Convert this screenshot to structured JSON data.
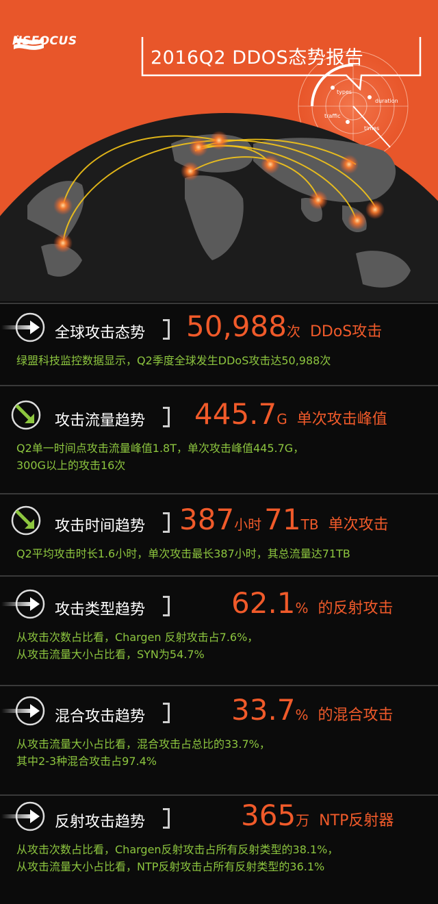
{
  "header": {
    "logo_text": "NSFOCUS",
    "title": "2016Q2 DDOS态势报告",
    "radar_labels": {
      "types": "types",
      "duration": "duration",
      "traffic": "traffic",
      "times": "times"
    }
  },
  "colors": {
    "accent": "#f05a2a",
    "hero_bg": "#e8562a",
    "desc": "#8dc63f"
  },
  "sections": [
    {
      "title": "全球攻击态势",
      "arrow": "right-arrow-icon",
      "num": "50,988",
      "unit": "次",
      "tail": "DDoS攻击",
      "lines": [
        "绿盟科技监控数据显示，Q2季度全球发生DDoS攻击达50,988次"
      ]
    },
    {
      "title": "攻击流量趋势",
      "arrow": "down-right-arrow-icon",
      "num": "445.7",
      "unit": "G",
      "tail": "单次攻击峰值",
      "lines": [
        "Q2单一时间点攻击流量峰值1.8T，单次攻击峰值445.7G，",
        "300G以上的攻击16次"
      ]
    },
    {
      "title": "攻击时间趋势",
      "arrow": "down-right-arrow-icon",
      "num": "387",
      "unit": "小时",
      "num2": "71",
      "unit2": "TB",
      "tail": "单次攻击",
      "lines": [
        "Q2平均攻击时长1.6小时，单次攻击最长387小时，其总流量达71TB"
      ]
    },
    {
      "title": "攻击类型趋势",
      "arrow": "right-arrow-icon",
      "num": "62.1",
      "unit": "%",
      "tail": "的反射攻击",
      "lines": [
        "从攻击次数占比看，Chargen 反射攻击占7.6%，",
        "从攻击流量大小占比看，SYN为54.7%"
      ]
    },
    {
      "title": "混合攻击趋势",
      "arrow": "right-arrow-icon",
      "num": "33.7",
      "unit": "%",
      "tail": "的混合攻击",
      "lines": [
        "从攻击流量大小占比看，混合攻击占总比的33.7%，",
        "其中2-3种混合攻击占97.4%"
      ]
    },
    {
      "title": "反射攻击趋势",
      "arrow": "right-arrow-icon",
      "num": "365",
      "unit": "万",
      "tail": "NTP反射器",
      "lines": [
        "从攻击次数占比看，Chargen反射攻击占所有反射类型的38.1%，",
        "从攻击流量大小占比看，NTP反射攻击占所有反射类型的36.1%"
      ]
    }
  ]
}
